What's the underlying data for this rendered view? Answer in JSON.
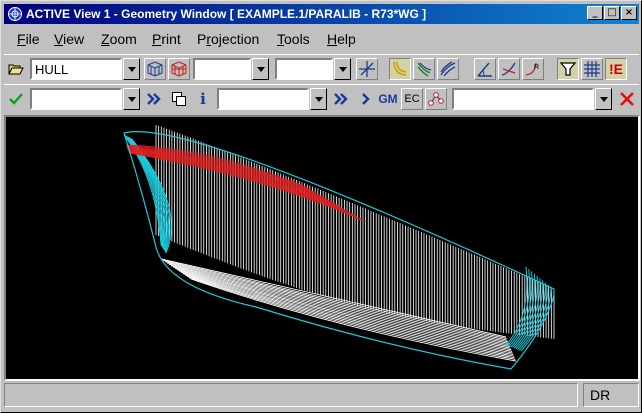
{
  "window": {
    "title": "ACTIVE View 1 - Geometry Window [ EXAMPLE.1/PARALIB - R73*WG ]",
    "controls": {
      "minimize": "_",
      "maximize": "□",
      "close": "×"
    }
  },
  "menu": [
    {
      "pre": "",
      "u": "F",
      "post": "ile"
    },
    {
      "pre": "",
      "u": "V",
      "post": "iew"
    },
    {
      "pre": "",
      "u": "Z",
      "post": "oom"
    },
    {
      "pre": "",
      "u": "P",
      "post": "rint"
    },
    {
      "pre": "P",
      "u": "r",
      "post": "ojection"
    },
    {
      "pre": "",
      "u": "T",
      "post": "ools"
    },
    {
      "pre": "",
      "u": "H",
      "post": "elp"
    }
  ],
  "toolbar1": {
    "object_select": {
      "value": "HULL"
    },
    "field_a": {
      "value": ""
    },
    "field_b": {
      "value": ""
    },
    "flag_label": "!E"
  },
  "toolbar2": {
    "command_field": {
      "value": ""
    },
    "name_field": {
      "value": ""
    },
    "search_field": {
      "value": ""
    },
    "gm_label": "GM",
    "ec_label": "EC",
    "info_label": "i"
  },
  "status": {
    "message": "",
    "mode": "DR"
  },
  "colors": {
    "titlebar_start": "#00007b",
    "titlebar_end": "#1084d0",
    "viewport_bg": "#000000",
    "hull_lines": "#ffffff",
    "section_lines": "#1ec8dc",
    "waterline_red": "#e02020"
  }
}
